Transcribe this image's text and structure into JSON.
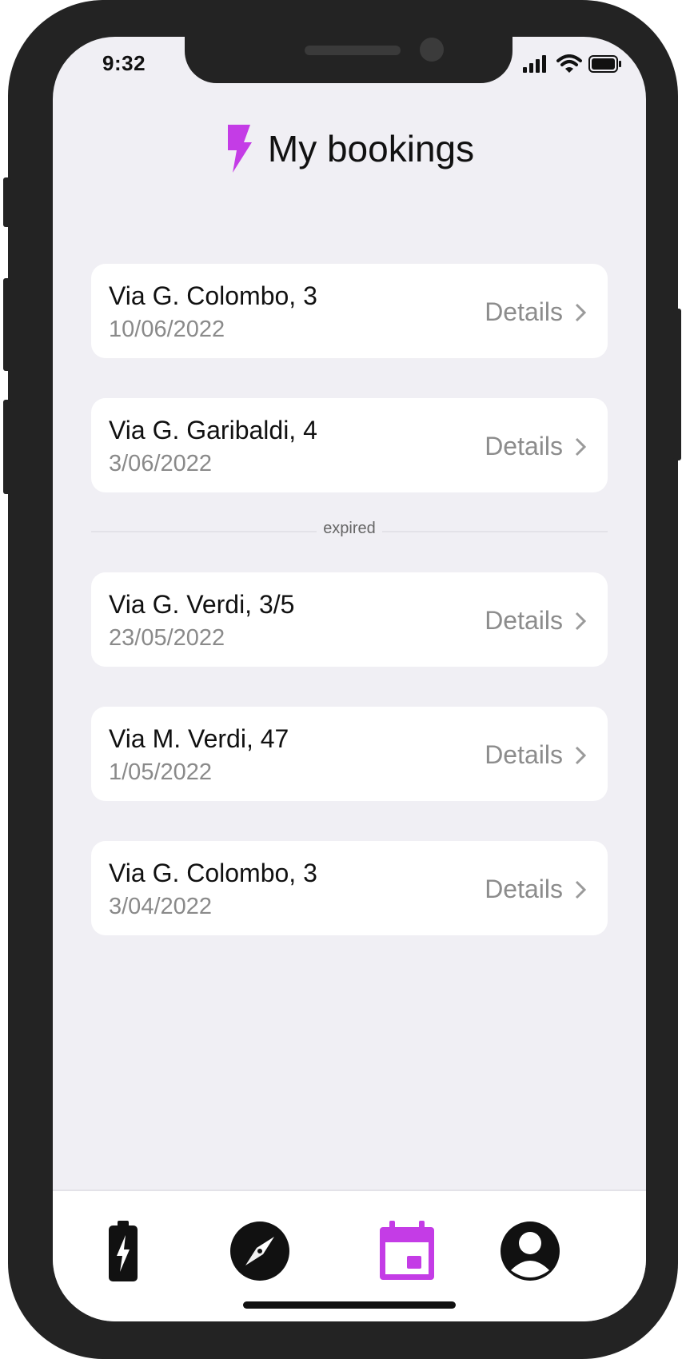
{
  "status_bar": {
    "time": "9:32"
  },
  "header": {
    "title": "My bookings",
    "icon": "bolt-icon",
    "accent_color": "#c43ce6"
  },
  "bookings": [
    {
      "address": "Via G. Colombo, 3",
      "date": "10/06/2022",
      "action": "Details"
    },
    {
      "address": "Via G. Garibaldi, 4",
      "date": "3/06/2022",
      "action": "Details"
    }
  ],
  "divider": {
    "label": "expired"
  },
  "expired_bookings": [
    {
      "address": "Via G. Verdi, 3/5",
      "date": "23/05/2022",
      "action": "Details"
    },
    {
      "address": "Via M. Verdi, 47",
      "date": "1/05/2022",
      "action": "Details"
    },
    {
      "address": "Via G. Colombo, 3",
      "date": "3/04/2022",
      "action": "Details"
    }
  ],
  "tab_bar": {
    "tabs": [
      {
        "name": "battery-charging-icon",
        "active": false
      },
      {
        "name": "compass-icon",
        "active": false
      },
      {
        "name": "calendar-icon",
        "active": true
      },
      {
        "name": "account-icon",
        "active": false
      }
    ],
    "active_color": "#c43ce6",
    "inactive_color": "#111111"
  }
}
